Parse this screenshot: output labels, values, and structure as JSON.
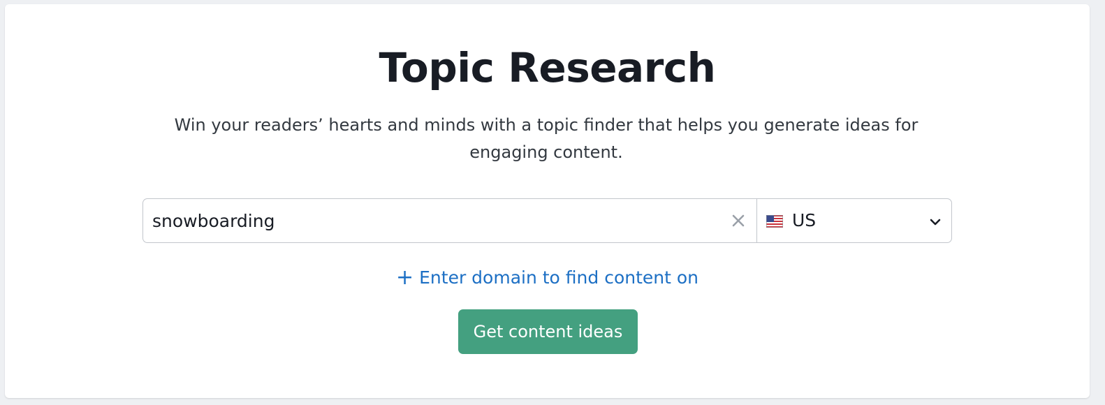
{
  "title": "Topic Research",
  "subtitle": "Win your readers’ hearts and minds with a topic finder that helps you generate ideas for engaging content.",
  "search": {
    "value": "snowboarding",
    "clear_icon": "close-icon"
  },
  "database": {
    "selected": "US",
    "flag_icon": "us-flag-icon",
    "dropdown_icon": "chevron-down-icon"
  },
  "domain_link": {
    "icon": "plus-icon",
    "plus": "+",
    "label": "Enter domain to find content on"
  },
  "cta": {
    "label": "Get content ideas"
  },
  "colors": {
    "primary_button": "#44a080",
    "link": "#1c6fc4",
    "title_text": "#181c24",
    "border": "#c2c6cc"
  }
}
